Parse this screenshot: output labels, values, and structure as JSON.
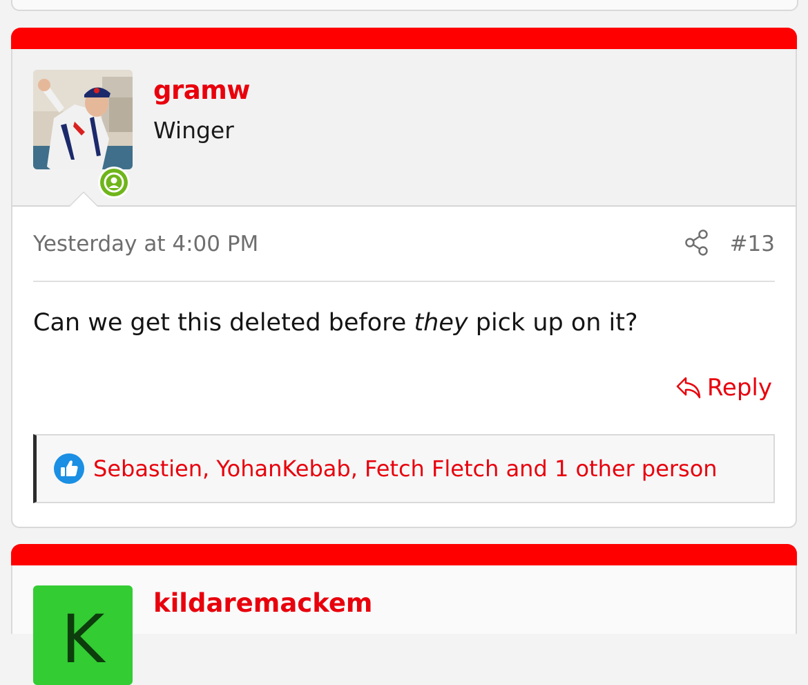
{
  "post": {
    "username": "gramw",
    "user_title": "Winger",
    "timestamp": "Yesterday at 4:00 PM",
    "post_number": "#13",
    "message_before": "Can we get this deleted before ",
    "message_emphasis": "they",
    "message_after": " pick up on it?",
    "reply_label": "Reply",
    "reactions_text": "Sebastien, YohanKebab, Fetch Fletch and 1 other person"
  },
  "next_post": {
    "username": "kildaremackem",
    "avatar_letter": "K"
  },
  "colors": {
    "accent": "#ff0000",
    "link": "#e8000c",
    "online": "#6fb51a",
    "like": "#1a8fe3",
    "avatar_bg": "#33cc33"
  },
  "icons": [
    "online-status-icon",
    "share-icon",
    "reply-icon",
    "like-icon"
  ]
}
